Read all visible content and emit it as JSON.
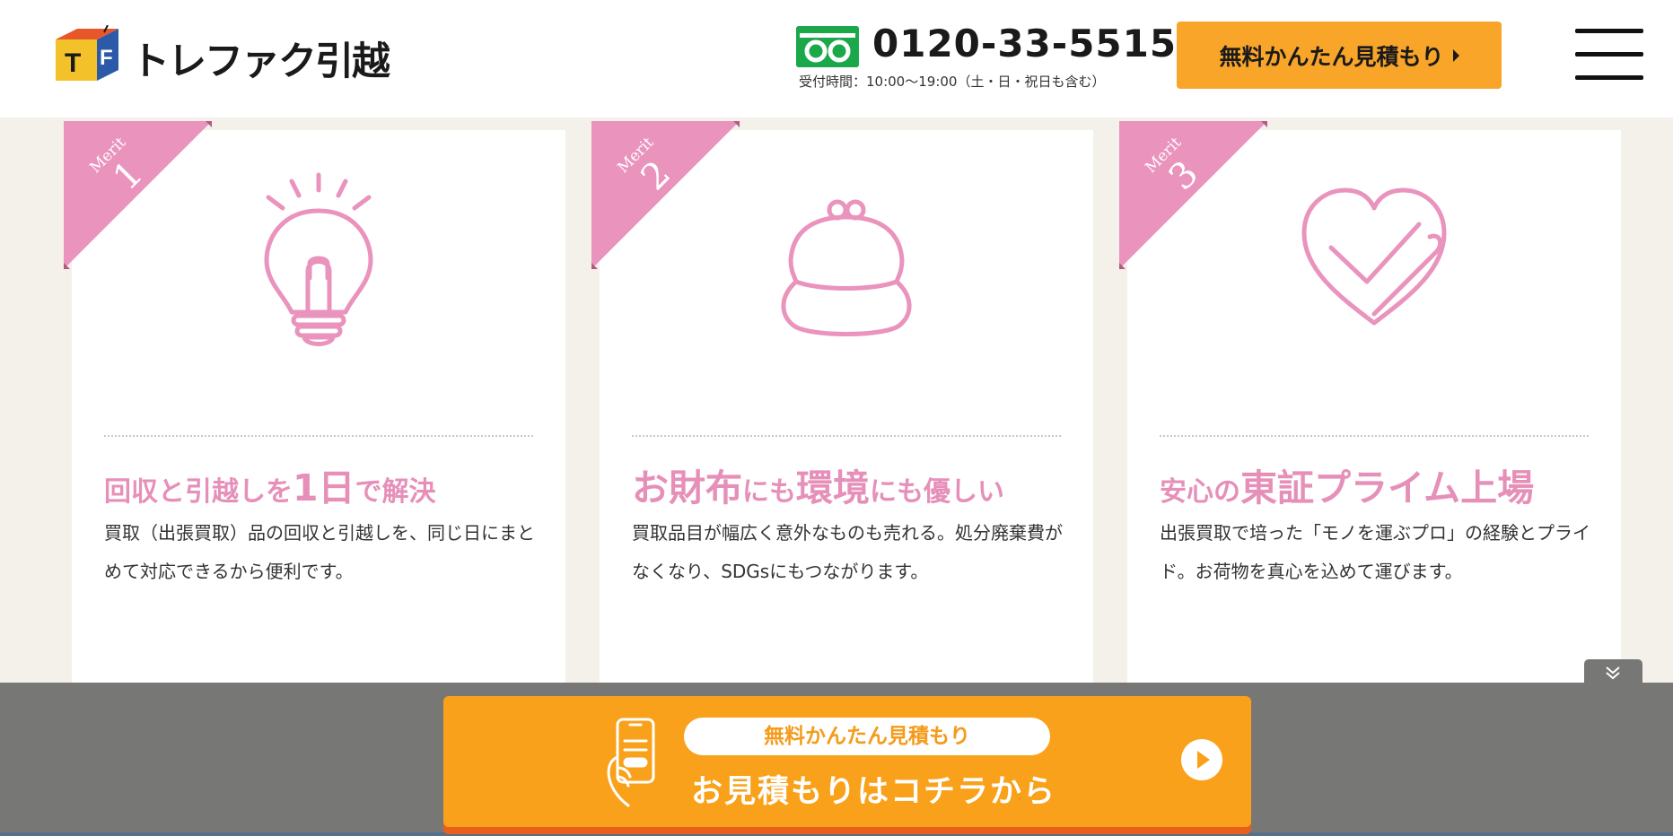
{
  "header": {
    "logo_text": "トレファク引越",
    "phone_number": "0120-33-5515",
    "hours": "受付時間：10:00〜19:00（土・日・祝日も含む）",
    "estimate_button": "無料かんたん見積もり"
  },
  "colors": {
    "accent_pink": "#e690b9",
    "accent_orange": "#f9a11a",
    "freedial_green": "#1aa84a"
  },
  "merits": [
    {
      "merit_label": "Merit",
      "number": "1",
      "icon": "lightbulb-icon",
      "title": [
        "回収と引越しを",
        "1日",
        "で解決"
      ],
      "description": "買取（出張買取）品の回収と引越しを、同じ日にまとめて対応できるから便利です。"
    },
    {
      "merit_label": "Merit",
      "number": "2",
      "icon": "wallet-icon",
      "title": [
        "お財布",
        "にも",
        "環境",
        "にも優しい"
      ],
      "description": "買取品目が幅広く意外なものも売れる。処分廃棄費がなくなり、SDGsにもつながります。"
    },
    {
      "merit_label": "Merit",
      "number": "3",
      "icon": "heart-check-icon",
      "title": [
        "安心の",
        "東証プライム上場"
      ],
      "description": "出張買取で培った「モノを運ぶプロ」の経験とプライド。お荷物を真心を込めて運びます。"
    }
  ],
  "cta": {
    "pill": "無料かんたん見積もり",
    "main": "お見積もりはコチラから"
  }
}
